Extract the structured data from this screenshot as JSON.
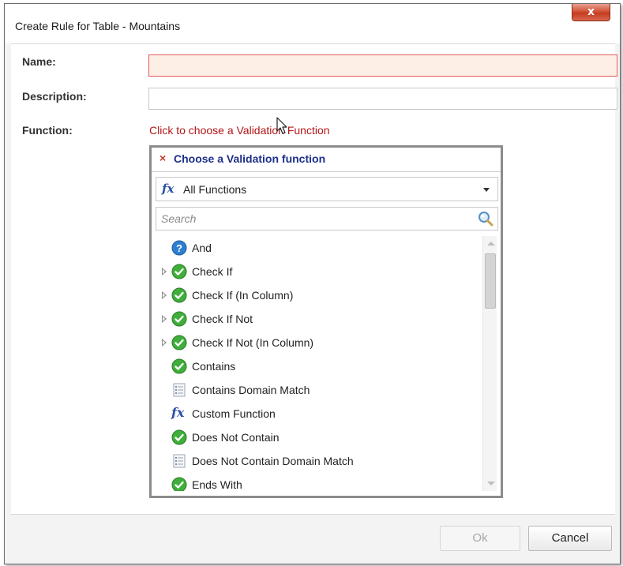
{
  "window": {
    "title": "Create Rule for Table - Mountains",
    "close_glyph": "x"
  },
  "form": {
    "name_label": "Name:",
    "name_value": "",
    "description_label": "Description:",
    "description_value": "",
    "function_label": "Function:",
    "function_link": "Click to choose a Validation Function"
  },
  "picker": {
    "close_glyph": "×",
    "title": "Choose a Validation function",
    "select_icon": "fx",
    "select_value": "All Functions",
    "search_placeholder": "Search",
    "items": [
      {
        "label": "And",
        "icon": "help-circle-icon",
        "expandable": false
      },
      {
        "label": "Check If",
        "icon": "green-check-icon",
        "expandable": true
      },
      {
        "label": "Check If (In Column)",
        "icon": "green-check-icon",
        "expandable": true
      },
      {
        "label": "Check If Not",
        "icon": "green-check-icon",
        "expandable": true
      },
      {
        "label": "Check If Not (In Column)",
        "icon": "green-check-icon",
        "expandable": true
      },
      {
        "label": "Contains",
        "icon": "green-check-icon",
        "expandable": false
      },
      {
        "label": "Contains Domain Match",
        "icon": "list-document-icon",
        "expandable": false
      },
      {
        "label": "Custom Function",
        "icon": "fx-icon",
        "expandable": false
      },
      {
        "label": "Does Not Contain",
        "icon": "green-check-icon",
        "expandable": false
      },
      {
        "label": "Does Not Contain Domain Match",
        "icon": "list-document-icon",
        "expandable": false
      },
      {
        "label": "Ends With",
        "icon": "green-check-icon",
        "expandable": false
      }
    ]
  },
  "footer": {
    "ok_label": "Ok",
    "cancel_label": "Cancel"
  },
  "colors": {
    "link_red": "#b31616",
    "title_blue": "#1d2f8a",
    "invalid_border": "#e25b5b",
    "invalid_fill": "#fdeee6"
  }
}
